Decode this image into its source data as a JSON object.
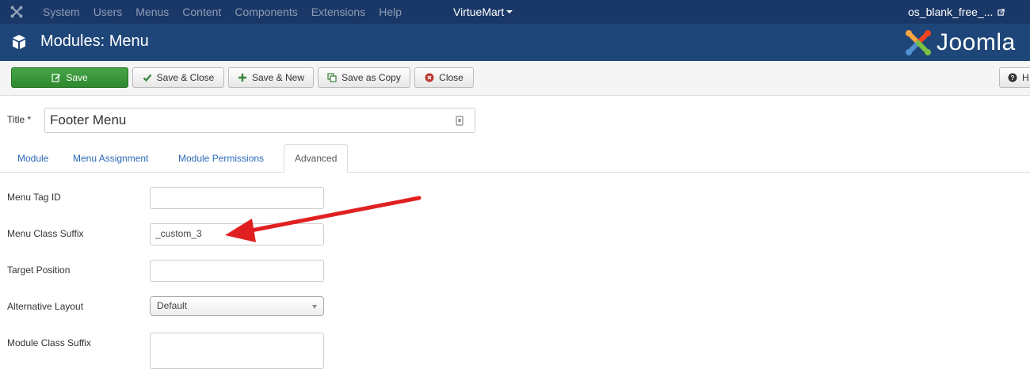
{
  "topnav": {
    "menu": [
      "System",
      "Users",
      "Menus",
      "Content",
      "Components",
      "Extensions",
      "Help"
    ],
    "virtuemart": "VirtueMart",
    "site": "os_blank_free_..."
  },
  "header": {
    "title": "Modules: Menu",
    "brand": "Joomla"
  },
  "toolbar": {
    "save": "Save",
    "save_close": "Save & Close",
    "save_new": "Save & New",
    "save_copy": "Save as Copy",
    "close": "Close",
    "help": "H"
  },
  "title_field": {
    "label": "Title *",
    "value": "Footer Menu"
  },
  "tabs": [
    "Module",
    "Menu Assignment",
    "Module Permissions",
    "Advanced"
  ],
  "form": {
    "menu_tag_id": {
      "label": "Menu Tag ID",
      "value": ""
    },
    "menu_class_suffix": {
      "label": "Menu Class Suffix",
      "value": "_custom_3"
    },
    "target_position": {
      "label": "Target Position",
      "value": ""
    },
    "alternative_layout": {
      "label": "Alternative Layout",
      "value": "Default"
    },
    "module_class_suffix": {
      "label": "Module Class Suffix",
      "value": ""
    }
  },
  "colors": {
    "topnav_bg": "#1a3867",
    "header_bg": "#1e4679",
    "save_green": "#3b973b",
    "link_blue": "#2a69b8",
    "annotation_red": "#e02020"
  },
  "icons": {
    "joomla_logo": "joomla-icon",
    "external_link": "external-link-icon",
    "module_cube": "cube-icon",
    "save": "edit-icon",
    "save_close": "check-icon",
    "save_new": "plus-icon",
    "save_copy": "copy-icon",
    "close": "close-circle-icon",
    "help": "question-circle-icon",
    "title_lock": "lock-icon",
    "select_caret": "caret-down-icon"
  }
}
